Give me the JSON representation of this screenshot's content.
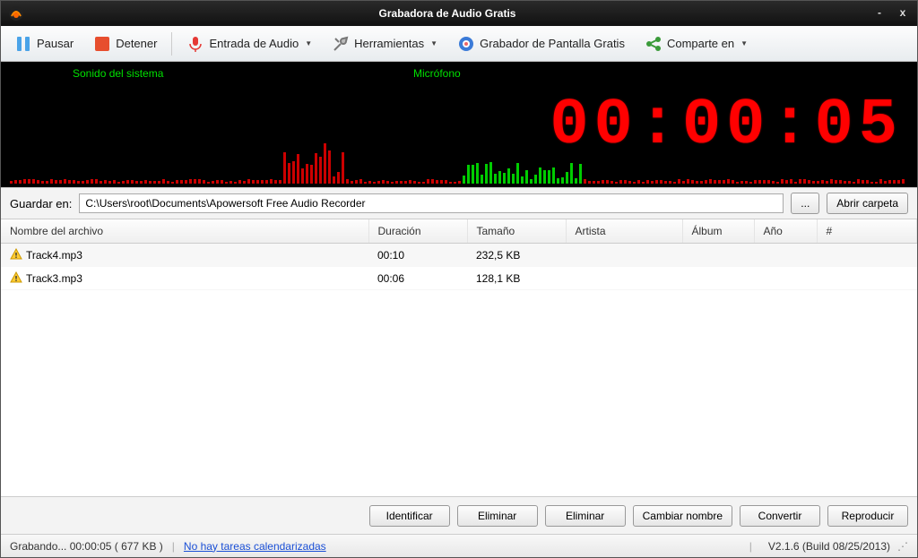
{
  "title": "Grabadora de Audio Gratis",
  "toolbar": {
    "pause": "Pausar",
    "stop": "Detener",
    "audio_input": "Entrada de Audio",
    "tools": "Herramientas",
    "screen_recorder": "Grabador de Pantalla Gratis",
    "share": "Comparte en"
  },
  "waveform": {
    "system_label": "Sonido del sistema",
    "mic_label": "Micrófono",
    "timer": "00:00:05"
  },
  "save": {
    "label": "Guardar en:",
    "path": "C:\\Users\\root\\Documents\\Apowersoft Free Audio Recorder",
    "browse": "...",
    "open_folder": "Abrir carpeta"
  },
  "columns": {
    "filename": "Nombre del archivo",
    "duration": "Duración",
    "size": "Tamaño",
    "artist": "Artista",
    "album": "Álbum",
    "year": "Año",
    "num": "#"
  },
  "tracks": [
    {
      "filename": "Track4.mp3",
      "duration": "00:10",
      "size": "232,5 KB",
      "artist": "",
      "album": "",
      "year": "",
      "num": ""
    },
    {
      "filename": "Track3.mp3",
      "duration": "00:06",
      "size": "128,1 KB",
      "artist": "",
      "album": "",
      "year": "",
      "num": ""
    }
  ],
  "actions": {
    "identify": "Identificar",
    "delete1": "Eliminar",
    "delete2": "Eliminar",
    "rename": "Cambiar nombre",
    "convert": "Convertir",
    "play": "Reproducir"
  },
  "status": {
    "recording": "Grabando... 00:00:05 ( 677 KB )",
    "no_tasks": "No hay tareas calendarizadas",
    "version": "V2.1.6 (Build 08/25/2013)"
  }
}
